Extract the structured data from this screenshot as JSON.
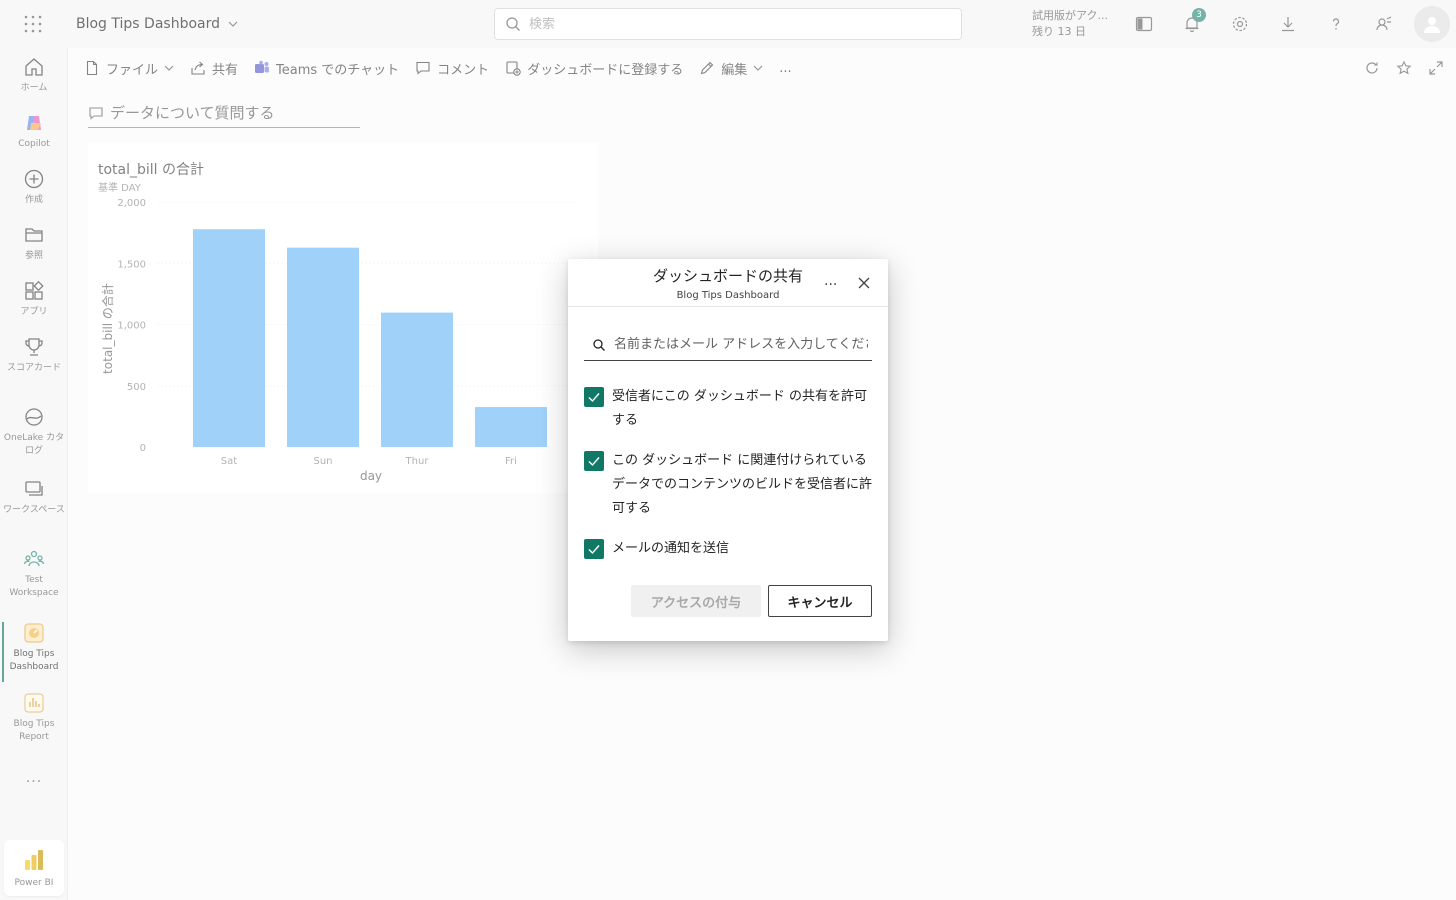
{
  "topbar": {
    "app_title": "Blog Tips Dashboard",
    "search_placeholder": "検索",
    "trial_line1": "試用版がアク...",
    "trial_line2": "残り 13 日",
    "notification_count": "3"
  },
  "rail": {
    "items": [
      {
        "label": "ホーム",
        "icon": "home-icon"
      },
      {
        "label": "Copilot",
        "icon": "copilot-icon"
      },
      {
        "label": "作成",
        "icon": "plus-circle-icon"
      },
      {
        "label": "参照",
        "icon": "folder-icon"
      },
      {
        "label": "アプリ",
        "icon": "apps-icon"
      },
      {
        "label": "スコアカード",
        "icon": "trophy-icon"
      },
      {
        "label": "OneLake カタログ",
        "icon": "onelake-icon"
      },
      {
        "label": "ワークスペース",
        "icon": "workspaces-icon"
      },
      {
        "label": "Test Workspace",
        "icon": "group-icon"
      },
      {
        "label": "Blog Tips Dashboard",
        "icon": "dashboard-icon"
      },
      {
        "label": "Blog Tips Report",
        "icon": "report-icon"
      }
    ],
    "more": "...",
    "footer_label": "Power BI"
  },
  "cmdbar": {
    "file": "ファイル",
    "share": "共有",
    "teams": "Teams でのチャット",
    "comment": "コメント",
    "pin": "ダッシュボードに登録する",
    "edit": "編集",
    "more": "..."
  },
  "qa": {
    "label": "データについて質問する"
  },
  "tile": {
    "title": "total_bill の合計",
    "subtitle": "基準 DAY"
  },
  "chart_data": {
    "type": "bar",
    "categories": [
      "Sat",
      "Sun",
      "Thur",
      "Fri"
    ],
    "values": [
      1778,
      1627,
      1097,
      326
    ],
    "ylim": [
      0,
      2000
    ],
    "yticks": [
      "0",
      "500",
      "1,000",
      "1,500",
      "2,000"
    ],
    "ytick_values": [
      0,
      500,
      1000,
      1500,
      2000
    ],
    "xlabel": "day",
    "ylabel": "total_bill の合計",
    "bar_color": "#6cb8f6",
    "grid": true
  },
  "dialog": {
    "title": "ダッシュボードの共有",
    "subtitle": "Blog Tips Dashboard",
    "more": "...",
    "search_placeholder": "名前またはメール アドレスを入力してください",
    "options": [
      {
        "label": "受信者にこの ダッシュボード の共有を許可する",
        "checked": true
      },
      {
        "label": "この ダッシュボード に関連付けられているデータでのコンテンツのビルドを受信者に許可する",
        "checked": true
      },
      {
        "label": "メールの通知を送信",
        "checked": true
      }
    ],
    "grant_label": "アクセスの付与",
    "cancel_label": "キャンセル"
  },
  "colors": {
    "accent": "#117865",
    "badge": "#2c8a7d"
  }
}
